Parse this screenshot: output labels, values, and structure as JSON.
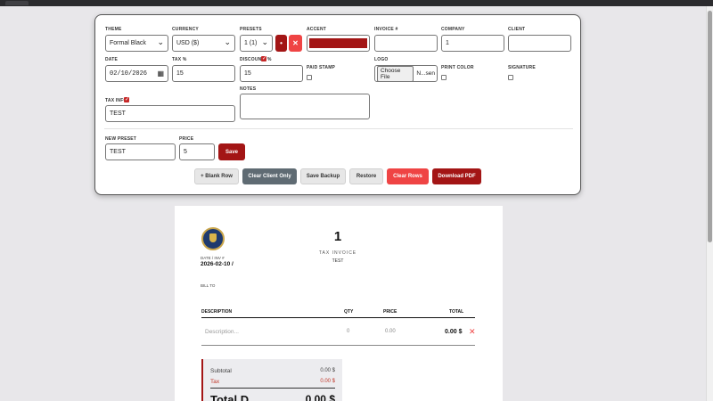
{
  "settings": {
    "theme": {
      "label": "THEME",
      "value": "Formal Black"
    },
    "currency": {
      "label": "CURRENCY",
      "value": "USD ($)"
    },
    "presets": {
      "label": "PRESETS",
      "value": "1 (1)",
      "apply_symbol": "•",
      "delete_symbol": "✕"
    },
    "accent": {
      "label": "ACCENT",
      "color": "#a31515"
    },
    "invoice_no": {
      "label": "INVOICE #",
      "value": ""
    },
    "company": {
      "label": "COMPANY",
      "value": "1"
    },
    "client": {
      "label": "CLIENT",
      "value": ""
    },
    "date": {
      "label": "DATE",
      "value": "02/10/2026"
    },
    "tax": {
      "label": "TAX %",
      "value": "15"
    },
    "discount": {
      "label": "DISCOUNT",
      "suffix": "%",
      "checked": true,
      "value": "15"
    },
    "paid_stamp": {
      "label": "PAID STAMP",
      "checked": false
    },
    "logo": {
      "label": "LOGO",
      "button": "Choose File",
      "file_text": "N...sen"
    },
    "print_color": {
      "label": "PRINT COLOR",
      "checked": false
    },
    "signature": {
      "label": "SIGNATURE",
      "checked": false
    },
    "tax_info": {
      "label": "TAX INFO",
      "checked": true,
      "value": "TEST"
    },
    "notes": {
      "label": "NOTES",
      "value": ""
    },
    "new_preset": {
      "label": "NEW PRESET",
      "value": "TEST"
    },
    "price": {
      "label": "PRICE",
      "value": "5"
    },
    "save_label": "Save"
  },
  "actions": {
    "blank_row": "+ Blank Row",
    "clear_client": "Clear Client Only",
    "save_backup": "Save Backup",
    "restore": "Restore",
    "clear_rows": "Clear Rows",
    "download_pdf": "Download PDF"
  },
  "invoice": {
    "number": "1",
    "doc_type": "TAX INVOICE",
    "tax_info": "TEST",
    "date_label": "DATE / INV #",
    "date_value": "2026-02-10 /",
    "bill_to": "BILL TO",
    "columns": {
      "description": "DESCRIPTION",
      "qty": "QTY",
      "price": "PRICE",
      "total": "TOTAL"
    },
    "row": {
      "description": "Description...",
      "qty": "0",
      "price": "0.00",
      "total": "0.00 $",
      "remove": "✕"
    },
    "summary": {
      "subtotal_label": "Subtotal",
      "subtotal_value": "0.00 $",
      "tax_label": "Tax",
      "tax_value": "0.00 $",
      "total_label": "Total D",
      "total_value": "0.00 $"
    }
  },
  "colors": {
    "accent": "#a31515",
    "danger": "#ef4444",
    "dark_button": "#5f6b73"
  }
}
